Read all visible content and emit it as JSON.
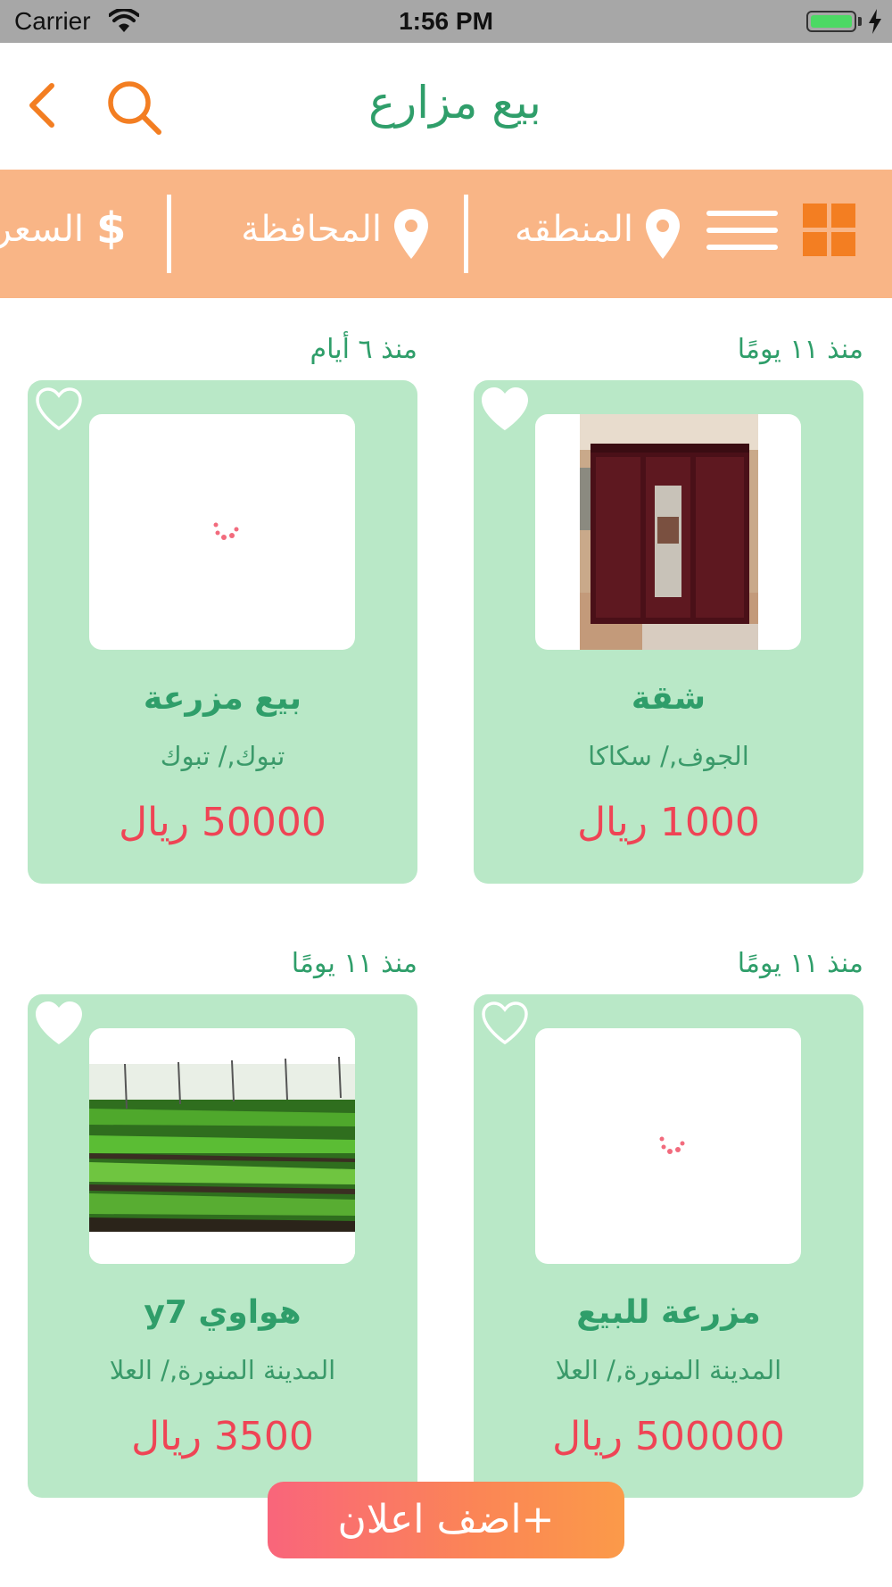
{
  "status_bar": {
    "carrier": "Carrier",
    "time": "1:56 PM"
  },
  "nav": {
    "title": "بيع مزارع",
    "back_icon": "chevron-left-icon",
    "search_icon": "search-icon"
  },
  "filters": {
    "region": "المنطقه",
    "province": "المحافظة",
    "price": "السعر",
    "accent": "#f37e22",
    "background": "#f9b586"
  },
  "listings": [
    {
      "time": "منذ ١١ يومًا",
      "title": "شقة",
      "location": "الجوف,/ سكاكا",
      "price": "1000 ريال",
      "heart": "filled",
      "image": "wardrobe-photo"
    },
    {
      "time": "منذ ٦ أيام",
      "title": "بيع مزرعة",
      "location": "تبوك,/ تبوك",
      "price": "50000 ريال",
      "heart": "outline",
      "image": "loading"
    },
    {
      "time": "منذ ١١ يومًا",
      "title": "مزرعة للبيع",
      "location": "المدينة المنورة,/ العلا",
      "price": "500000 ريال",
      "heart": "outline",
      "image": "loading"
    },
    {
      "time": "منذ ١١ يومًا",
      "title": "هواوي y7",
      "location": "المدينة المنورة,/ العلا",
      "price": "3500 ريال",
      "heart": "filled",
      "image": "greenhouse-photo"
    }
  ],
  "add_button": {
    "label": "+اضف اعلان"
  },
  "colors": {
    "green_text": "#2f9e6a",
    "card_bg": "#b9e8c7",
    "price": "#ef4455"
  }
}
